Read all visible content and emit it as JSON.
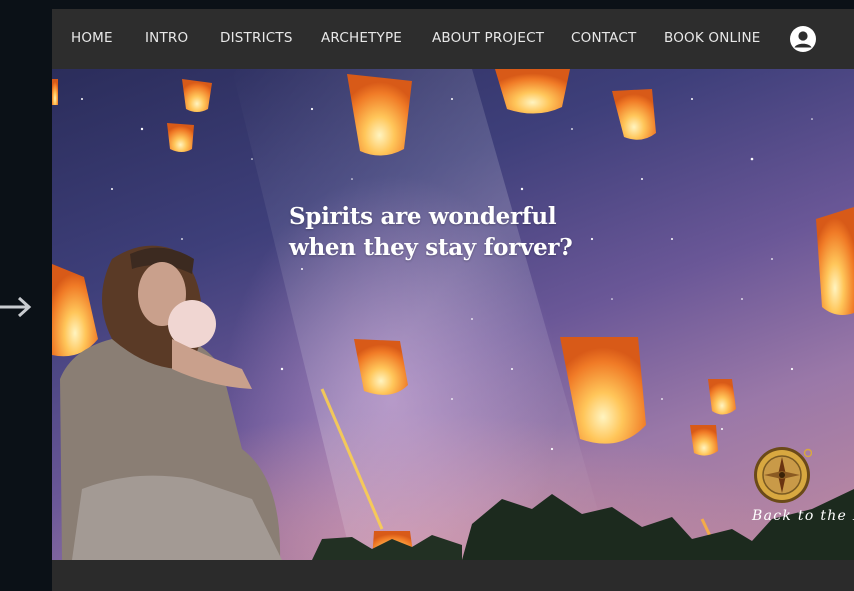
{
  "nav": {
    "items": [
      {
        "label": "HOME"
      },
      {
        "label": "INTRO"
      },
      {
        "label": "DISTRICTS"
      },
      {
        "label": "ARCHETYPE"
      },
      {
        "label": "ABOUT PROJECT"
      },
      {
        "label": "CONTACT"
      },
      {
        "label": "BOOK ONLINE"
      }
    ],
    "user_icon": "user-account-icon"
  },
  "hero": {
    "headline_line1": "Spirits are wonderful",
    "headline_line2": "when they stay forver?",
    "back_link_label": "Back to the M",
    "compass_icon": "compass-icon"
  },
  "gutter": {
    "arrow_icon": "arrow-right-icon"
  },
  "colors": {
    "nav_bg": "#2d2d2d",
    "page_bg": "#0b1117",
    "nav_text": "#e8e8e8",
    "lantern_orange": "#f28a2e",
    "lantern_glow": "#ffe9a8"
  }
}
